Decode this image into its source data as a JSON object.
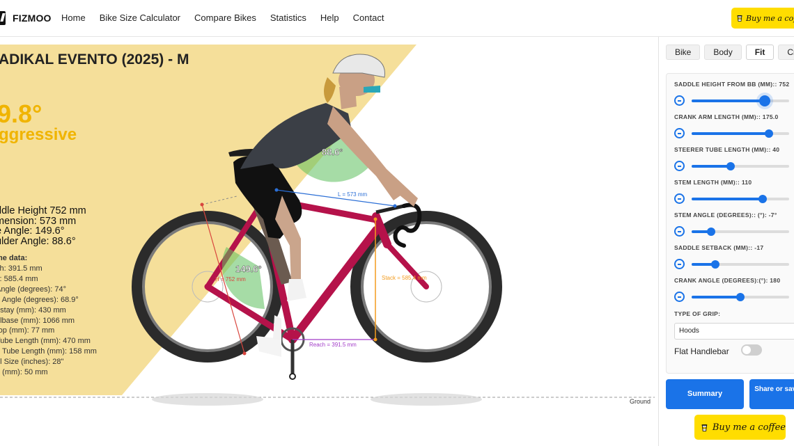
{
  "header": {
    "brand": "FIZMOO",
    "nav": [
      "Home",
      "Bike Size Calculator",
      "Compare Bikes",
      "Statistics",
      "Help",
      "Contact"
    ],
    "coffee_label": "Buy me a coffee"
  },
  "bike": {
    "title": "ADIKAL EVENTO (2025) - M",
    "angle_value": "9.8°",
    "category": "ggressive",
    "metrics": [
      "ddle Height 752 mm",
      "mension: 573 mm",
      "e Angle: 149.6°",
      "ulder Angle: 88.6°"
    ],
    "frame_title": "me data:",
    "frame_data": [
      "ch: 391.5 mm",
      "k: 585.4 mm",
      " Angle (degrees): 74°",
      "d Angle (degrees): 68.9°",
      "nstay (mm): 430 mm",
      "elbase (mm): 1066 mm",
      "rop (mm): 77 mm",
      "Tube Length (mm): 470 mm",
      "d Tube Length (mm): 158 mm",
      "el Size (inches): 28\"",
      "e (mm): 50 mm"
    ]
  },
  "diagram": {
    "shoulder_angle": "88.6°",
    "knee_angle": "149.6°",
    "dimension_label": "L = 573 mm",
    "height_label": "H = 752 mm",
    "stack_label": "Stack = 585.4 mm",
    "reach_label": "Reach = 391.5 mm",
    "ground_label": "Ground",
    "colors": {
      "frame": "#b5124a",
      "accent": "#f0b400",
      "wedge": "#f5df9a",
      "green": "#5cbf5c",
      "blue": "#2b6fd6",
      "orange": "#f39c1f",
      "purple": "#a23bc8",
      "red": "#d9453d"
    }
  },
  "panel": {
    "tabs": [
      {
        "label": "Bike",
        "active": false
      },
      {
        "label": "Body",
        "active": false
      },
      {
        "label": "Fit",
        "active": true
      },
      {
        "label": "Cr",
        "active": false
      }
    ],
    "sliders": [
      {
        "label": "SADDLE HEIGHT FROM BB (MM):: 752",
        "level": 0.75,
        "big": true
      },
      {
        "label": "CRANK ARM LENGTH (MM):: 175.0",
        "level": 0.79,
        "big": false
      },
      {
        "label": "STEERER TUBE LENGTH (MM):: 40",
        "level": 0.4,
        "big": false
      },
      {
        "label": "STEM LENGTH (MM):: 110",
        "level": 0.73,
        "big": false
      },
      {
        "label": "STEM ANGLE (DEGREES):: (°): -7°",
        "level": 0.2,
        "big": false
      },
      {
        "label": "SADDLE SETBACK (MM):: -17",
        "level": 0.24,
        "big": false
      },
      {
        "label": "CRANK ANGLE (DEGREES):(°): 180",
        "level": 0.5,
        "big": false
      }
    ],
    "grip_label": "TYPE OF GRIP:",
    "grip_value": "Hoods",
    "flat_handlebar_label": "Flat Handlebar",
    "flat_handlebar_on": false,
    "summary_label": "Summary",
    "share_label": "Share or save link",
    "coffee_label": "Buy me a coffee"
  }
}
